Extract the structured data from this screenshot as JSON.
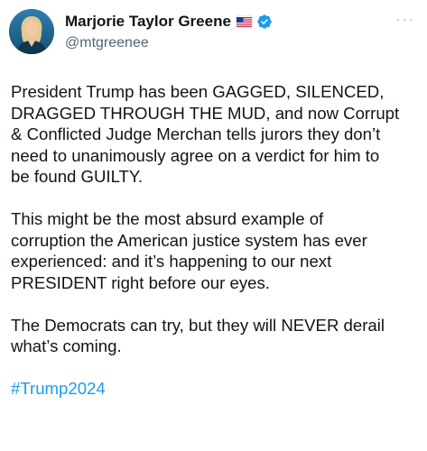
{
  "author": {
    "display_name": "Marjorie Taylor Greene",
    "handle": "@mtgreenee",
    "flag_icon": "us-flag-icon",
    "verified_icon": "verified-badge-icon",
    "verified_color": "#1d9bf0"
  },
  "tweet": {
    "paragraphs": [
      "President Trump has been GAGGED, SILENCED,\nDRAGGED THROUGH THE MUD, and now Corrupt\n& Conflicted Judge Merchan tells jurors they don’t\nneed to unanimously agree on a verdict for him to\nbe found GUILTY.",
      "This might be the most absurd example of\ncorruption the American justice system has ever\nexperienced: and it’s happening to our next\nPRESIDENT right before our eyes.",
      "The Democrats can try, but they will NEVER derail\nwhat’s coming."
    ],
    "hashtag": "#Trump2024",
    "hashtag_color": "#1d9bf0"
  },
  "icons": {
    "more": "more-options-icon",
    "avatar": "avatar"
  }
}
